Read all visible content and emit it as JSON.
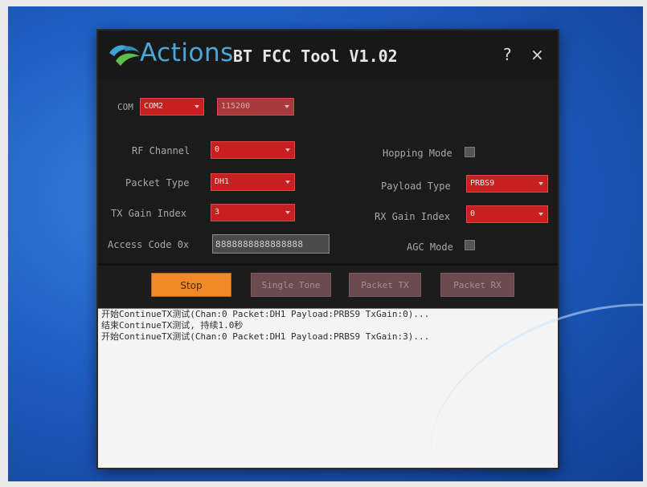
{
  "window": {
    "brand": "Actions",
    "title": "BT FCC Tool V1.02",
    "help": "?",
    "close": "×"
  },
  "com": {
    "label": "COM",
    "port": "COM2",
    "baud": "115200"
  },
  "fields": {
    "rf_channel": {
      "label": "RF Channel",
      "value": "0"
    },
    "packet_type": {
      "label": "Packet Type",
      "value": "DH1"
    },
    "tx_gain_index": {
      "label": "TX Gain Index",
      "value": "3"
    },
    "access_code": {
      "label": "Access Code 0x",
      "value": "8888888888888888"
    },
    "hopping_mode": {
      "label": "Hopping Mode"
    },
    "payload_type": {
      "label": "Payload Type",
      "value": "PRBS9"
    },
    "rx_gain_index": {
      "label": "RX Gain Index",
      "value": "0"
    },
    "agc_mode": {
      "label": "AGC Mode"
    }
  },
  "buttons": {
    "stop": "Stop",
    "single_tone": "Single Tone",
    "packet_tx": "Packet TX",
    "packet_rx": "Packet RX"
  },
  "log": [
    "开始ContinueTX测试(Chan:0 Packet:DH1 Payload:PRBS9 TxGain:0)...",
    "结束ContinueTX测试, 持续1.0秒",
    "开始ContinueTX测试(Chan:0 Packet:DH1 Payload:PRBS9 TxGain:3)..."
  ],
  "colors": {
    "accent_orange": "#f08a28",
    "brand_blue": "#4aa7d8",
    "field_red": "#c82020"
  }
}
